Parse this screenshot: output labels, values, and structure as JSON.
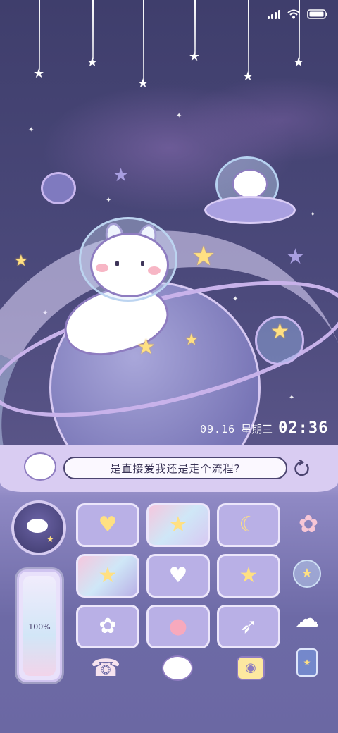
{
  "status_bar": {
    "signal": "signal-icon",
    "wifi": "wifi-icon",
    "battery": "battery-icon"
  },
  "clock": {
    "date": "09.16",
    "weekday": "星期三",
    "time": "02:36"
  },
  "search": {
    "text": "是直接爱我还是走个流程?"
  },
  "battery_widget": {
    "level_percent": 100,
    "label": "100%"
  },
  "grid": {
    "row1": [
      {
        "icon": "heart-wand-icon"
      },
      {
        "icon": "rainbow-stars-icon"
      },
      {
        "icon": "moon-cloud-icon"
      }
    ],
    "row2": [
      {
        "icon": "rainbow-icon"
      },
      {
        "icon": "bunny-heart-icon"
      },
      {
        "icon": "milk-bottle-icon"
      }
    ],
    "row3": [
      {
        "icon": "bunny-stars-icon"
      },
      {
        "icon": "strawberry-cloud-icon"
      },
      {
        "icon": "rocket-icon"
      }
    ]
  },
  "side_icons": [
    "flower-icon",
    "bubble-star-icon",
    "cloud-face-icon",
    "star-jar-icon"
  ],
  "dock": [
    "telephone-icon",
    "bunny-icon",
    "camera-icon"
  ],
  "colors": {
    "panel": "#8f89c4",
    "tile": "#b9b0e6",
    "banner": "#d9ccf2",
    "star_yellow": "#ffe082"
  }
}
